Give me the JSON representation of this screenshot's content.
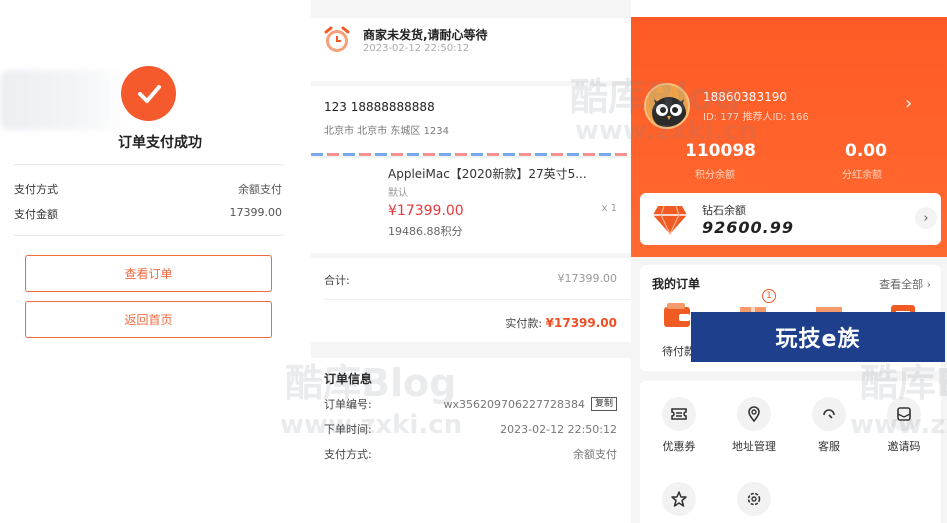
{
  "left": {
    "title": "订单支付成功",
    "payment_method_label": "支付方式",
    "payment_method_value": "余额支付",
    "payment_amount_label": "支付金额",
    "payment_amount_value": "17399.00",
    "view_order_button": "查看订单",
    "back_home_button": "返回首页"
  },
  "middle": {
    "notice_title": "商家未发货,请耐心等待",
    "notice_time": "2023-02-12  22:50:12",
    "address_name": "123    18888888888",
    "address_detail": "北京市 北京市 东城区 1234",
    "product_name": "AppleiMac【2020新款】27英寸5...",
    "product_spec": "默认",
    "product_price": "¥17399.00",
    "product_qty": "x 1",
    "product_points": "19486.88积分",
    "total_label": "合计:",
    "total_value": "¥17399.00",
    "paid_label": "实付款:",
    "paid_value": "¥17399.00",
    "info_title": "订单信息",
    "order_no_label": "订单编号:",
    "order_no_value": "wx356209706227728384",
    "copy_button": "复制",
    "order_time_label": "下单时间:",
    "order_time_value": "2023-02-12 22:50:12",
    "pay_method_label": "支付方式:",
    "pay_method_value": "余额支付"
  },
  "right": {
    "phone": "18860383190",
    "ids": "ID: 177   推荐人ID: 166",
    "points_value": "110098",
    "points_label": "积分余额",
    "dividend_value": "0.00",
    "dividend_label": "分红余额",
    "diamond_label": "钻石余额",
    "diamond_value": "92600.99",
    "orders_title": "我的订单",
    "orders_view_all": "查看全部",
    "order_tabs": [
      {
        "label": "待付款"
      }
    ],
    "badge_count": "1",
    "services": [
      {
        "label": "优惠券",
        "icon": "coupon-icon"
      },
      {
        "label": "地址管理",
        "icon": "location-icon"
      },
      {
        "label": "客服",
        "icon": "headset-icon"
      },
      {
        "label": "邀请码",
        "icon": "invite-icon"
      },
      {
        "label": "",
        "icon": "star-icon"
      },
      {
        "label": "",
        "icon": "settings-icon"
      }
    ]
  },
  "watermarks": {
    "brand": "酷库Blog",
    "url": "www.zxki.cn",
    "banner": "玩技e族"
  },
  "colors": {
    "accent": "#f55a2c",
    "price_red": "#e4393c",
    "banner_blue": "#1d3f8c"
  }
}
